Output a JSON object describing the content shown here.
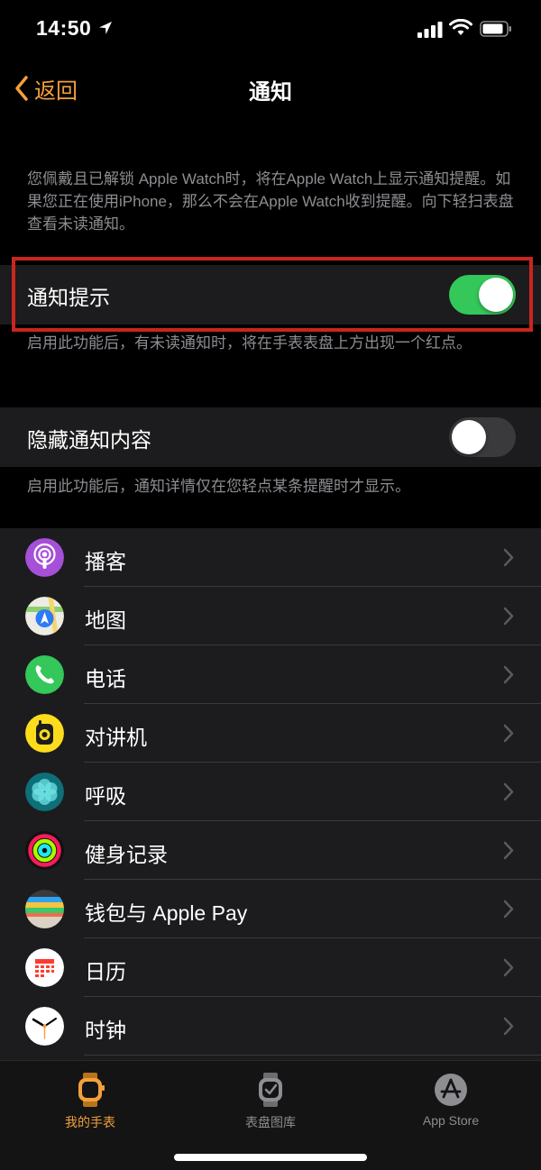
{
  "status_bar": {
    "time": "14:50",
    "icons": [
      "location-arrow-icon",
      "cellular-signal-icon",
      "wifi-icon",
      "battery-icon"
    ]
  },
  "nav": {
    "back_label": "返回",
    "title": "通知"
  },
  "description_top": "您佩戴且已解锁 Apple Watch时，将在Apple Watch上显示通知提醒。如果您正在使用iPhone，那么不会在Apple Watch收到提醒。向下轻扫表盘查看未读通知。",
  "notification_indicator": {
    "label": "通知提示",
    "enabled": true,
    "footer": "启用此功能后，有未读通知时，将在手表表盘上方出现一个红点。"
  },
  "hide_content": {
    "label": "隐藏通知内容",
    "enabled": false,
    "footer": "启用此功能后，通知详情仅在您轻点某条提醒时才显示。"
  },
  "apps": [
    {
      "label": "播客",
      "icon": "podcasts-icon"
    },
    {
      "label": "地图",
      "icon": "maps-icon"
    },
    {
      "label": "电话",
      "icon": "phone-icon"
    },
    {
      "label": "对讲机",
      "icon": "walkie-talkie-icon"
    },
    {
      "label": "呼吸",
      "icon": "breathe-icon"
    },
    {
      "label": "健身记录",
      "icon": "activity-icon"
    },
    {
      "label": "钱包与 Apple Pay",
      "icon": "wallet-icon"
    },
    {
      "label": "日历",
      "icon": "calendar-icon"
    },
    {
      "label": "时钟",
      "icon": "clock-icon"
    }
  ],
  "tabs": [
    {
      "label": "我的手表",
      "icon": "my-watch-icon",
      "active": true
    },
    {
      "label": "表盘图库",
      "icon": "face-gallery-icon",
      "active": false
    },
    {
      "label": "App Store",
      "icon": "app-store-icon",
      "active": false
    }
  ],
  "colors": {
    "accent": "#f3a03a",
    "toggle_on": "#34c759",
    "highlight": "#c8261f",
    "row_bg": "#1c1c1e"
  }
}
